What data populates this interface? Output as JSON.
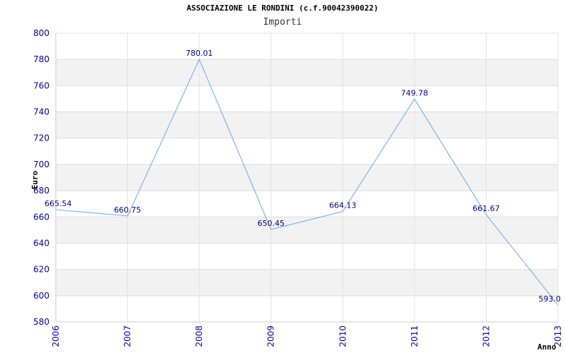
{
  "title": "ASSOCIAZIONE LE RONDINI (c.f.90042390022)",
  "chart_data": {
    "type": "line",
    "title": "ASSOCIAZIONE LE RONDINI (c.f.90042390022)",
    "subtitle": "Importi",
    "xlabel": "Anno",
    "ylabel": "Euro",
    "categories": [
      "2006",
      "2007",
      "2008",
      "2009",
      "2010",
      "2011",
      "2012",
      "2013"
    ],
    "values": [
      665.54,
      660.75,
      780.01,
      650.45,
      664.13,
      749.78,
      661.67,
      593.0
    ],
    "value_labels": [
      "665.54",
      "660.75",
      "780.01",
      "650.45",
      "664.13",
      "749.78",
      "661.67",
      "593.0"
    ],
    "ylim": [
      580,
      800
    ],
    "yticks": [
      "580",
      "600",
      "620",
      "640",
      "660",
      "680",
      "700",
      "720",
      "740",
      "760",
      "780",
      "800"
    ],
    "grid": true,
    "line_color": "#66aaee",
    "band_color": "#f2f2f2",
    "tick_color": "#0000aa"
  }
}
